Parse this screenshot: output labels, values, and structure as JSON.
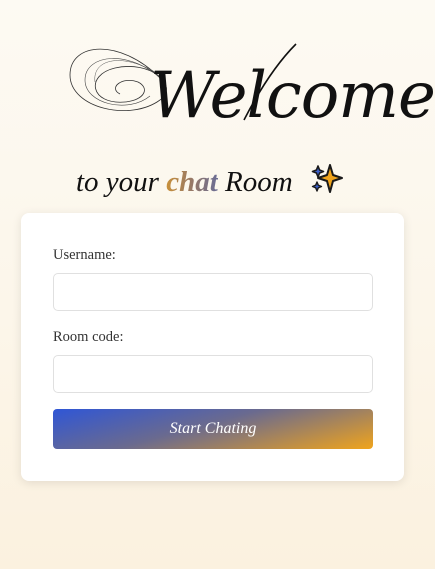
{
  "header": {
    "welcome": "Welcome",
    "subtitle_pre": "to your",
    "subtitle_highlight": "chat",
    "subtitle_post": "Room",
    "sparkle_icon": "sparkles-icon"
  },
  "form": {
    "username_label": "Username:",
    "username_value": "",
    "room_label": "Room code:",
    "room_value": "",
    "submit_label": "Start Chating"
  },
  "colors": {
    "background": "#fcf6ea",
    "card": "#ffffff",
    "button_gradient_start": "#2f56d6",
    "button_gradient_end": "#f0a41c",
    "chat_highlight_start": "#c9913a",
    "chat_highlight_end": "#6a6d95"
  }
}
